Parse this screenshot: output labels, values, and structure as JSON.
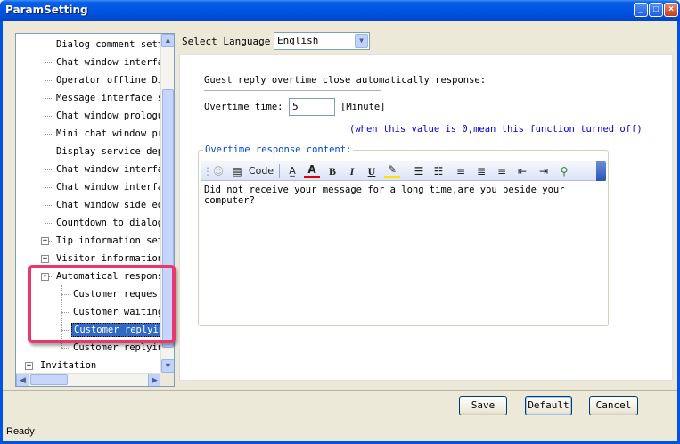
{
  "window": {
    "title": "ParamSetting",
    "controls": [
      "minimize",
      "maximize",
      "close"
    ]
  },
  "tree": {
    "items": [
      {
        "label": "Dialog comment setti",
        "level": 2,
        "expander": null,
        "selected": false
      },
      {
        "label": "Chat window interfac",
        "level": 2,
        "expander": null,
        "selected": false
      },
      {
        "label": "Operator offline Dis",
        "level": 2,
        "expander": null,
        "selected": false
      },
      {
        "label": "Message interface se",
        "level": 2,
        "expander": null,
        "selected": false
      },
      {
        "label": "Chat window prologue",
        "level": 2,
        "expander": null,
        "selected": false
      },
      {
        "label": "Mini chat window pro",
        "level": 2,
        "expander": null,
        "selected": false
      },
      {
        "label": "Display service depa",
        "level": 2,
        "expander": null,
        "selected": false
      },
      {
        "label": "Chat window interfac",
        "level": 2,
        "expander": null,
        "selected": false
      },
      {
        "label": "Chat window interfac",
        "level": 2,
        "expander": null,
        "selected": false
      },
      {
        "label": "Chat window side edg",
        "level": 2,
        "expander": null,
        "selected": false
      },
      {
        "label": "Countdown to dialog",
        "level": 2,
        "expander": null,
        "selected": false
      },
      {
        "label": "Tip information sett",
        "level": 2,
        "expander": "+",
        "selected": false
      },
      {
        "label": "Visitor information",
        "level": 2,
        "expander": "+",
        "selected": false
      },
      {
        "label": "Automatical response",
        "level": 2,
        "expander": "-",
        "selected": false
      },
      {
        "label": "Customer requesti",
        "level": 3,
        "expander": null,
        "selected": false
      },
      {
        "label": "Customer waiting",
        "level": 3,
        "expander": null,
        "selected": false
      },
      {
        "label": "Customer replying",
        "level": 3,
        "expander": null,
        "selected": true
      },
      {
        "label": "Customer replying",
        "level": 3,
        "expander": null,
        "selected": false
      },
      {
        "label": "Invitation",
        "level": 1,
        "expander": "+",
        "selected": false
      }
    ]
  },
  "language": {
    "label": "Select Language",
    "value": "English"
  },
  "settings": {
    "section_title": "Guest reply overtime close automatically response:",
    "overtime_label": "Overtime time:",
    "overtime_value": "5",
    "overtime_unit": "[Minute]",
    "overtime_hint": "(when this value is 0,mean this function turned off)",
    "content_legend": "Overtime response content:",
    "content_text": "Did not receive your message for a long time,are you beside your computer?"
  },
  "editor_toolbar": {
    "code_label": "Code",
    "bold": "B",
    "italic": "I",
    "underline": "U"
  },
  "buttons": {
    "save": "Save",
    "default": "Default",
    "cancel": "Cancel"
  },
  "status": {
    "text": "Ready"
  },
  "colors": {
    "titlebar": "#0054e3",
    "selection": "#316ac5",
    "highlight": "#e8386d",
    "hint": "#0000cc",
    "legend": "#0046d5"
  }
}
